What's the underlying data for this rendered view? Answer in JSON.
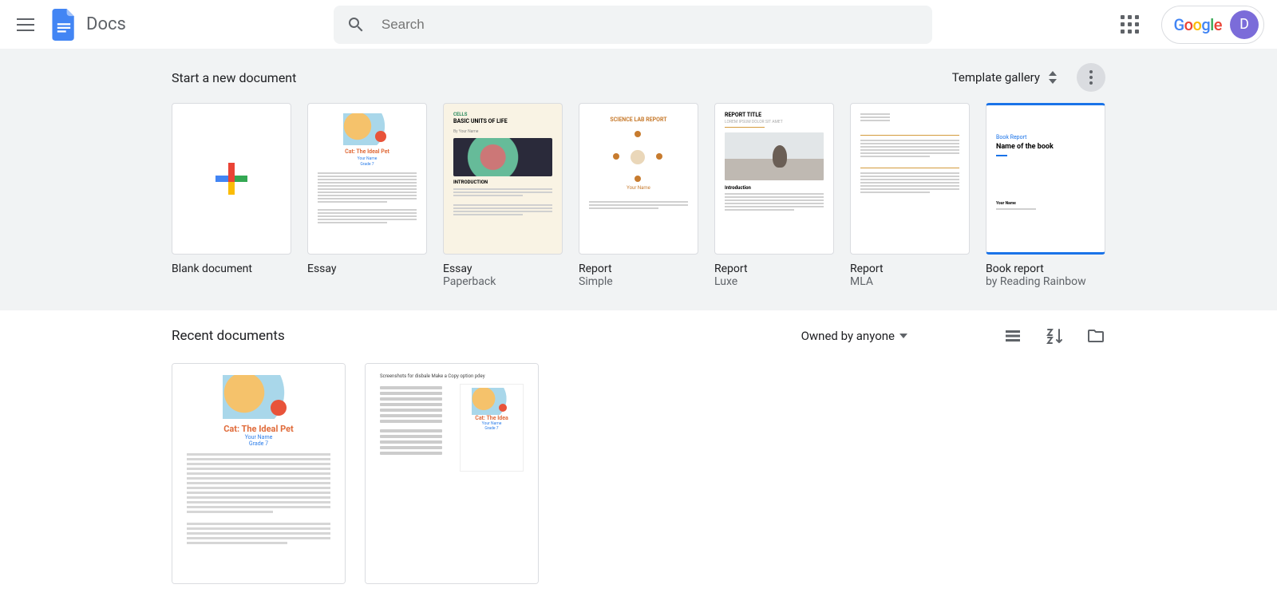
{
  "app": {
    "title": "Docs"
  },
  "search": {
    "placeholder": "Search"
  },
  "user": {
    "initial": "D"
  },
  "templates": {
    "heading": "Start a new document",
    "gallery_label": "Template gallery",
    "items": [
      {
        "title": "Blank document",
        "subtitle": ""
      },
      {
        "title": "Essay",
        "subtitle": ""
      },
      {
        "title": "Essay",
        "subtitle": "Paperback"
      },
      {
        "title": "Report",
        "subtitle": "Simple"
      },
      {
        "title": "Report",
        "subtitle": "Luxe"
      },
      {
        "title": "Report",
        "subtitle": "MLA"
      },
      {
        "title": "Book report",
        "subtitle": "by Reading Rainbow"
      }
    ]
  },
  "recent": {
    "heading": "Recent documents",
    "owner_filter": "Owned by anyone"
  },
  "thumb": {
    "essay1": {
      "title": "Cat: The Ideal Pet",
      "byline1": "Your Name",
      "byline2": "Grade 7"
    },
    "essay2": {
      "tag": "CELLS",
      "title": "BASIC UNITS OF LIFE",
      "by": "By Your Name",
      "intro": "INTRODUCTION"
    },
    "report1": {
      "title": "SCIENCE LAB REPORT",
      "by": "Your Name"
    },
    "report2": {
      "title": "REPORT TITLE",
      "sub": "LOREM IPSUM DOLOR SIT AMET",
      "intro": "Introduction"
    },
    "book": {
      "small": "Book Report",
      "big": "Name of the book",
      "by": "Your Name"
    }
  },
  "doc": {
    "essay1": {
      "title": "Cat: The Ideal Pet",
      "byline1": "Your Name",
      "byline2": "Grade 7"
    },
    "ss": {
      "caption": "Screenshots for disbale Make a Copy option pdey",
      "title2": "Cat: The Idea",
      "by1": "Your Name",
      "by2": "Grade 7"
    }
  }
}
